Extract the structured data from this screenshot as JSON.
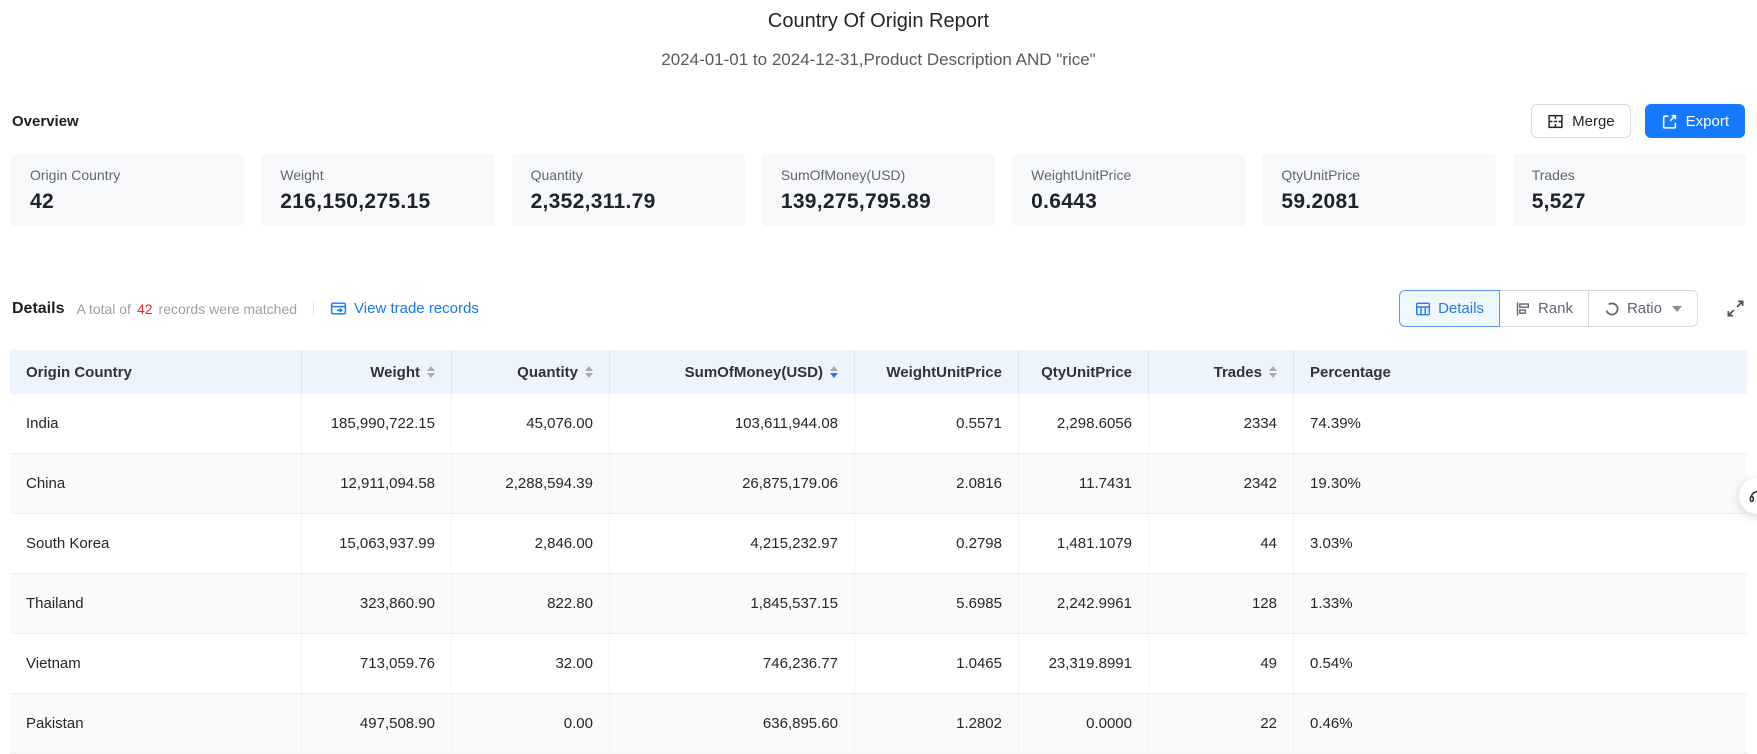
{
  "page": {
    "title": "Country Of Origin Report",
    "subtitle": "2024-01-01 to 2024-12-31,Product Description AND \"rice\""
  },
  "overview": {
    "heading": "Overview",
    "merge_label": "Merge",
    "export_label": "Export",
    "cards": [
      {
        "label": "Origin Country",
        "value": "42"
      },
      {
        "label": "Weight",
        "value": "216,150,275.15"
      },
      {
        "label": "Quantity",
        "value": "2,352,311.79"
      },
      {
        "label": "SumOfMoney(USD)",
        "value": "139,275,795.89"
      },
      {
        "label": "WeightUnitPrice",
        "value": "0.6443"
      },
      {
        "label": "QtyUnitPrice",
        "value": "59.2081"
      },
      {
        "label": "Trades",
        "value": "5,527"
      }
    ]
  },
  "details": {
    "heading": "Details",
    "summary_prefix": "A total of",
    "summary_count": "42",
    "summary_suffix": "records were matched",
    "view_link_label": "View trade records",
    "tabs": [
      {
        "label": "Details",
        "active": true,
        "icon": "table-icon"
      },
      {
        "label": "Rank",
        "active": false,
        "icon": "rank-icon"
      },
      {
        "label": "Ratio",
        "active": false,
        "icon": "ratio-icon",
        "dropdown": true
      }
    ]
  },
  "table": {
    "columns": [
      {
        "label": "Origin Country",
        "align": "left",
        "sortable": false,
        "sort": null
      },
      {
        "label": "Weight",
        "align": "right",
        "sortable": true,
        "sort": null
      },
      {
        "label": "Quantity",
        "align": "right",
        "sortable": true,
        "sort": null
      },
      {
        "label": "SumOfMoney(USD)",
        "align": "right",
        "sortable": true,
        "sort": "desc"
      },
      {
        "label": "WeightUnitPrice",
        "align": "right",
        "sortable": false,
        "sort": null
      },
      {
        "label": "QtyUnitPrice",
        "align": "right",
        "sortable": false,
        "sort": null
      },
      {
        "label": "Trades",
        "align": "right",
        "sortable": true,
        "sort": null
      },
      {
        "label": "Percentage",
        "align": "left",
        "sortable": false,
        "sort": null
      }
    ],
    "rows": [
      [
        "India",
        "185,990,722.15",
        "45,076.00",
        "103,611,944.08",
        "0.5571",
        "2,298.6056",
        "2334",
        "74.39%"
      ],
      [
        "China",
        "12,911,094.58",
        "2,288,594.39",
        "26,875,179.06",
        "2.0816",
        "11.7431",
        "2342",
        "19.30%"
      ],
      [
        "South Korea",
        "15,063,937.99",
        "2,846.00",
        "4,215,232.97",
        "0.2798",
        "1,481.1079",
        "44",
        "3.03%"
      ],
      [
        "Thailand",
        "323,860.90",
        "822.80",
        "1,845,537.15",
        "5.6985",
        "2,242.9961",
        "128",
        "1.33%"
      ],
      [
        "Vietnam",
        "713,059.76",
        "32.00",
        "746,236.77",
        "1.0465",
        "23,319.8991",
        "49",
        "0.54%"
      ],
      [
        "Pakistan",
        "497,508.90",
        "0.00",
        "636,895.60",
        "1.2802",
        "0.0000",
        "22",
        "0.46%"
      ]
    ]
  },
  "colors": {
    "accent_blue": "#1677ff",
    "count_red": "#f5222d",
    "header_bg": "#eef4fe",
    "card_bg": "#f7f8fa"
  }
}
